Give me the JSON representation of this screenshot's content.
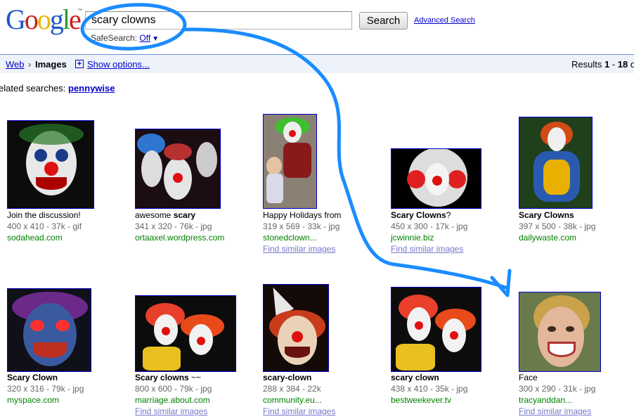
{
  "header": {
    "logo": "Google",
    "search_value": "scary clowns",
    "search_button": "Search",
    "advanced_search": "Advanced Search",
    "safesearch_label": "SafeSearch:",
    "safesearch_value": "Off"
  },
  "bar": {
    "web": "Web",
    "images": "Images",
    "show_options": "Show options...",
    "results_prefix": "Results ",
    "results_from": "1",
    "results_dash": " - ",
    "results_to": "18",
    "results_suffix": " o"
  },
  "related": {
    "label": "elated searches: ",
    "link": "pennywise"
  },
  "results": [
    {
      "title_pre": "Join the discussion!",
      "title_bold": "",
      "meta": "400 x 410 - 37k - gif",
      "domain": "sodahead.com",
      "similar": ""
    },
    {
      "title_pre": "awesome ",
      "title_bold": "scary",
      "meta": "341 x 320 - 76k - jpg",
      "domain": "ortaaxel.wordpress.com",
      "similar": ""
    },
    {
      "title_pre": "Happy Holidays from",
      "title_bold": "",
      "meta": "319 x 569 - 33k - jpg",
      "domain": "stonedclown...",
      "similar": "Find similar images"
    },
    {
      "title_pre": "",
      "title_bold": "Scary Clowns",
      "title_post": "?",
      "meta": "450 x 300 - 17k - jpg",
      "domain": "jcwinnie.biz",
      "similar": "Find similar images"
    },
    {
      "title_pre": "",
      "title_bold": "Scary Clowns",
      "meta": "397 x 500 - 38k - jpg",
      "domain": "dailywaste.com",
      "similar": ""
    },
    {
      "title_pre": "",
      "title_bold": "Scary Clown",
      "meta": "320 x 316 - 79k - jpg",
      "domain": "myspace.com",
      "similar": ""
    },
    {
      "title_pre": "",
      "title_bold": "Scary clowns",
      "title_post": " ~~",
      "meta": "800 x 600 - 79k - jpg",
      "domain": "marriage.about.com",
      "similar": "Find similar images"
    },
    {
      "title_pre": "",
      "title_bold": "scary-clown",
      "meta": "288 x 384 - 22k",
      "domain": "community.eu...",
      "similar": "Find similar images"
    },
    {
      "title_pre": "",
      "title_bold": "scary clown",
      "meta": "438 x 410 - 35k - jpg",
      "domain": "bestweekever.tv",
      "similar": ""
    },
    {
      "title_pre": "Face",
      "title_bold": "",
      "meta": "300 x 290 - 31k - jpg",
      "domain": "tracyanddan...",
      "similar": "Find similar images"
    }
  ],
  "colors": {
    "link": "#0000cc",
    "domain_green": "#008000",
    "annotation_blue": "#1a8cff",
    "bar_bg": "#eef3fb"
  }
}
